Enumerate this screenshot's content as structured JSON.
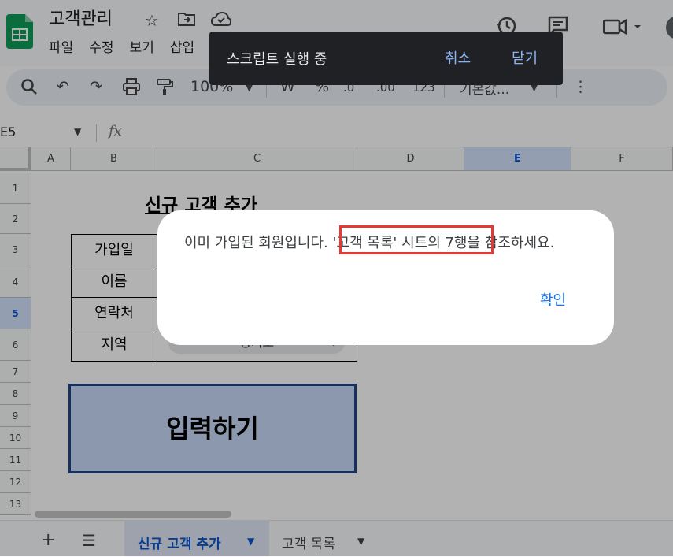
{
  "header": {
    "title": "고객관리",
    "menu": [
      "파일",
      "수정",
      "보기",
      "삽입"
    ]
  },
  "toolbar": {
    "zoom": "100%",
    "format_currency": "₩",
    "format_percent": "%",
    "decrease_decimal": ".0",
    "increase_decimal": ".00",
    "number_format": "123",
    "font": "기본값..."
  },
  "formula_bar": {
    "name_box": "E5",
    "fx": "fx"
  },
  "grid": {
    "columns": [
      "A",
      "B",
      "C",
      "D",
      "E",
      "F"
    ],
    "selected_column": "E",
    "rows": [
      "1",
      "2",
      "3",
      "4",
      "5",
      "6",
      "7",
      "8",
      "9",
      "10",
      "11",
      "12",
      "13"
    ],
    "selected_row": "5"
  },
  "sheet": {
    "title": "신규 고객 추가",
    "labels": [
      "가입일",
      "이름",
      "연락처",
      "지역"
    ],
    "region_value": "경기도",
    "submit_button": "입력하기"
  },
  "tabs": {
    "active": "신규 고객 추가",
    "second": "고객 목록"
  },
  "snackbar": {
    "text": "스크립트 실행 중",
    "cancel": "취소",
    "close": "닫기"
  },
  "dialog": {
    "message_before": "이미 가입된 회원입니다. ",
    "message_highlight": "'고객 목록' 시트의 7행",
    "message_after": "을 참조하세요.",
    "ok": "확인"
  },
  "colors": {
    "accent": "#0b57d0",
    "highlight_box": "#e53935",
    "button_fill": "#c9daf8",
    "button_border": "#1c4587"
  }
}
